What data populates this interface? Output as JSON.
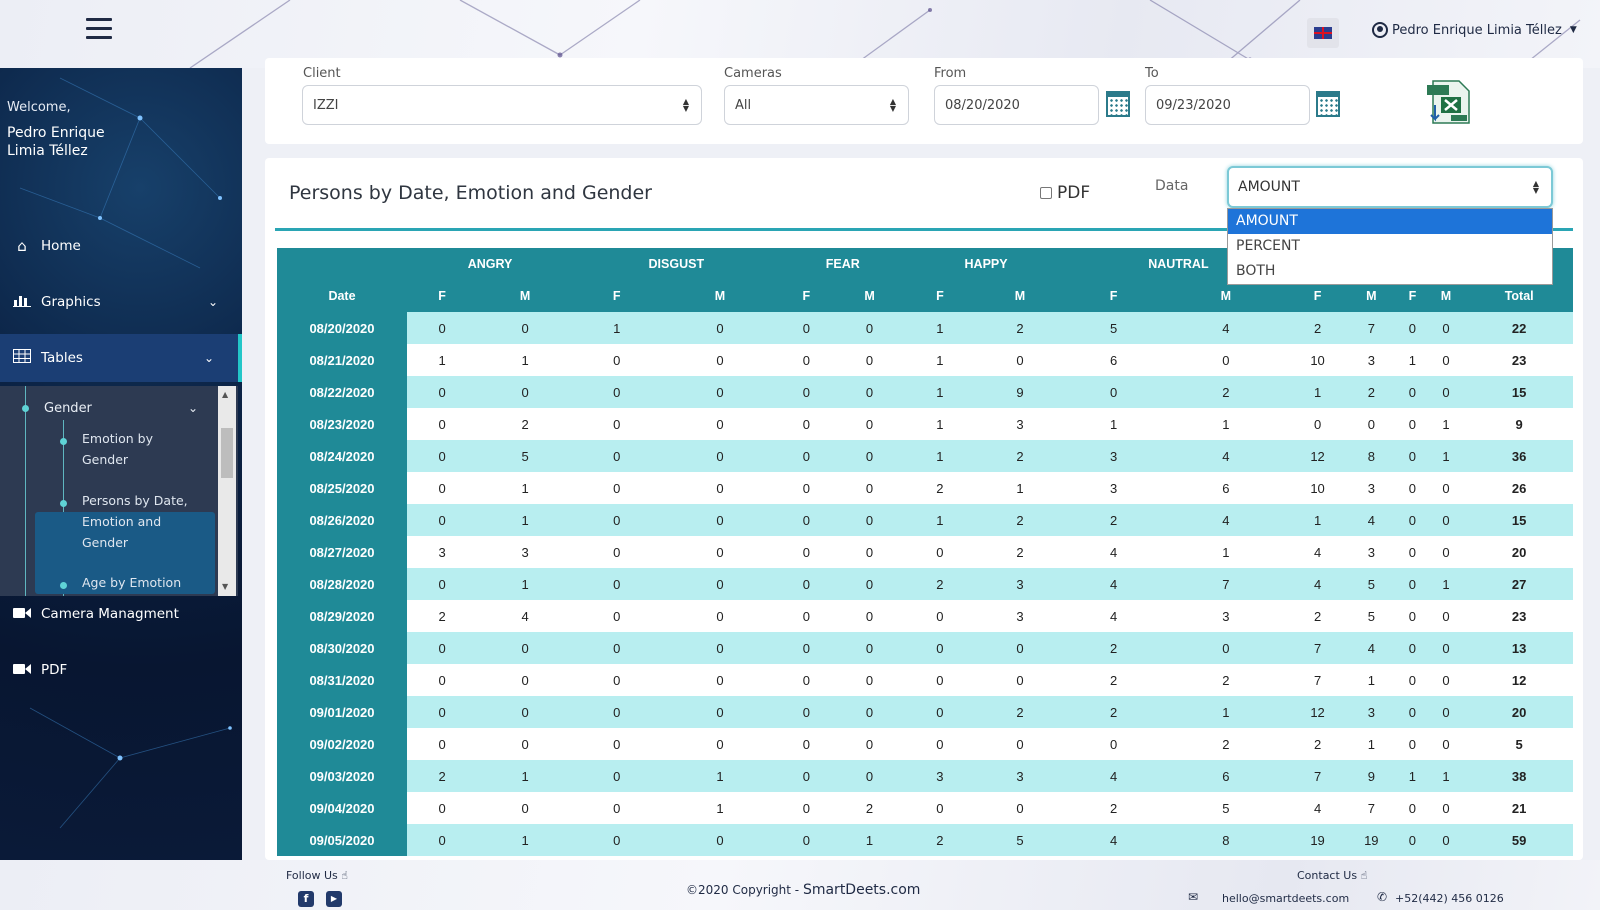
{
  "header": {
    "user_name": "Pedro Enrique Limia Téllez"
  },
  "sidebar": {
    "welcome": "Welcome,",
    "user_name": "Pedro Enrique Limia Téllez",
    "items": [
      {
        "label": "Home",
        "icon": "home-icon"
      },
      {
        "label": "Graphics",
        "icon": "bar-chart-icon"
      },
      {
        "label": "Tables",
        "icon": "table-icon"
      },
      {
        "label": "Camera Managment",
        "icon": "video-camera-icon"
      },
      {
        "label": "PDF",
        "icon": "video-camera-icon"
      }
    ],
    "submenu": {
      "group": "Gender",
      "items": [
        "Emotion by Gender",
        "Persons by Date, Emotion and Gender",
        "Age by Emotion"
      ]
    }
  },
  "filters": {
    "client_label": "Client",
    "client_value": "IZZI",
    "cameras_label": "Cameras",
    "cameras_value": "All",
    "from_label": "From",
    "from_value": "08/20/2020",
    "to_label": "To",
    "to_value": "09/23/2020"
  },
  "report": {
    "title": "Persons by Date, Emotion and Gender",
    "pdf_label": "PDF",
    "data_label": "Data",
    "data_value": "AMOUNT",
    "data_options": [
      "AMOUNT",
      "PERCENT",
      "BOTH"
    ]
  },
  "table": {
    "emotions": [
      "ANGRY",
      "DISGUST",
      "FEAR",
      "HAPPY",
      "NAUTRAL",
      "",
      ""
    ],
    "date_header": "Date",
    "sub_headers": [
      "F",
      "M"
    ],
    "total_header": "Total",
    "rows": [
      [
        "08/20/2020",
        0,
        0,
        1,
        0,
        0,
        0,
        1,
        2,
        5,
        4,
        2,
        7,
        0,
        0,
        22
      ],
      [
        "08/21/2020",
        1,
        1,
        0,
        0,
        0,
        0,
        1,
        0,
        6,
        0,
        10,
        3,
        1,
        0,
        23
      ],
      [
        "08/22/2020",
        0,
        0,
        0,
        0,
        0,
        0,
        1,
        9,
        0,
        2,
        1,
        2,
        0,
        0,
        15
      ],
      [
        "08/23/2020",
        0,
        2,
        0,
        0,
        0,
        0,
        1,
        3,
        1,
        1,
        0,
        0,
        0,
        1,
        9
      ],
      [
        "08/24/2020",
        0,
        5,
        0,
        0,
        0,
        0,
        1,
        2,
        3,
        4,
        12,
        8,
        0,
        1,
        36
      ],
      [
        "08/25/2020",
        0,
        1,
        0,
        0,
        0,
        0,
        2,
        1,
        3,
        6,
        10,
        3,
        0,
        0,
        26
      ],
      [
        "08/26/2020",
        0,
        1,
        0,
        0,
        0,
        0,
        1,
        2,
        2,
        4,
        1,
        4,
        0,
        0,
        15
      ],
      [
        "08/27/2020",
        3,
        3,
        0,
        0,
        0,
        0,
        0,
        2,
        4,
        1,
        4,
        3,
        0,
        0,
        20
      ],
      [
        "08/28/2020",
        0,
        1,
        0,
        0,
        0,
        0,
        2,
        3,
        4,
        7,
        4,
        5,
        0,
        1,
        27
      ],
      [
        "08/29/2020",
        2,
        4,
        0,
        0,
        0,
        0,
        0,
        3,
        4,
        3,
        2,
        5,
        0,
        0,
        23
      ],
      [
        "08/30/2020",
        0,
        0,
        0,
        0,
        0,
        0,
        0,
        0,
        2,
        0,
        7,
        4,
        0,
        0,
        13
      ],
      [
        "08/31/2020",
        0,
        0,
        0,
        0,
        0,
        0,
        0,
        0,
        2,
        2,
        7,
        1,
        0,
        0,
        12
      ],
      [
        "09/01/2020",
        0,
        0,
        0,
        0,
        0,
        0,
        0,
        2,
        2,
        1,
        12,
        3,
        0,
        0,
        20
      ],
      [
        "09/02/2020",
        0,
        0,
        0,
        0,
        0,
        0,
        0,
        0,
        0,
        2,
        2,
        1,
        0,
        0,
        5
      ],
      [
        "09/03/2020",
        2,
        1,
        0,
        1,
        0,
        0,
        3,
        3,
        4,
        6,
        7,
        9,
        1,
        1,
        38
      ],
      [
        "09/04/2020",
        0,
        0,
        0,
        1,
        0,
        2,
        0,
        0,
        2,
        5,
        4,
        7,
        0,
        0,
        21
      ],
      [
        "09/05/2020",
        0,
        1,
        0,
        0,
        0,
        1,
        2,
        5,
        4,
        8,
        19,
        19,
        0,
        0,
        59
      ]
    ]
  },
  "footer": {
    "follow_us": "Follow Us",
    "copyright": "©2020 Copyright - ",
    "brand": "SmartDeets.com",
    "contact_us": "Contact Us",
    "email": "hello@smartdeets.com",
    "phone": "+52(442) 456 0126"
  }
}
